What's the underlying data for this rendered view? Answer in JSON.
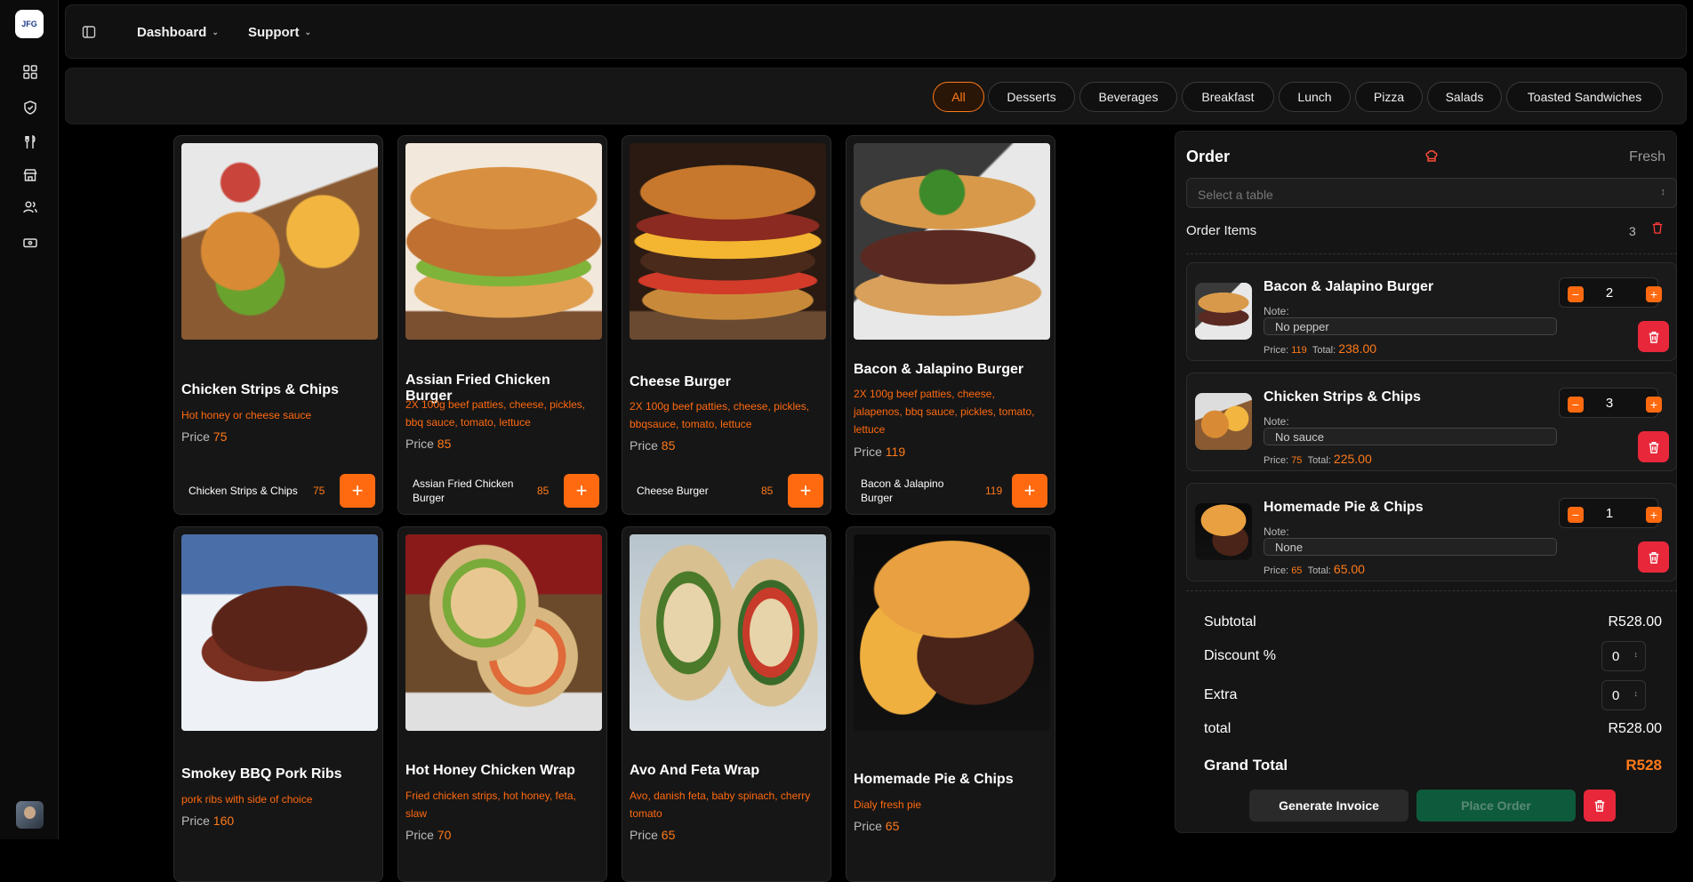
{
  "app": {
    "logo_text": "JFG"
  },
  "topbar": {
    "nav": [
      {
        "label": "Dashboard"
      },
      {
        "label": "Support"
      }
    ]
  },
  "categories": [
    {
      "label": "All",
      "active": true
    },
    {
      "label": "Desserts"
    },
    {
      "label": "Beverages"
    },
    {
      "label": "Breakfast"
    },
    {
      "label": "Lunch"
    },
    {
      "label": "Pizza"
    },
    {
      "label": "Salads"
    },
    {
      "label": "Toasted Sandwiches"
    }
  ],
  "menu_items": [
    {
      "name": "Chicken Strips & Chips",
      "description": "Hot honey or cheese sauce",
      "price_label": "Price",
      "price": "75",
      "footer_name": "Chicken Strips & Chips",
      "footer_price": "75"
    },
    {
      "name": "Assian Fried Chicken Burger",
      "description": "2X 100g beef patties, cheese, pickles, bbq sauce, tomato, lettuce",
      "price_label": "Price",
      "price": "85",
      "footer_name": "Assian Fried Chicken Burger",
      "footer_price": "85"
    },
    {
      "name": "Cheese Burger",
      "description": "2X 100g beef patties, cheese, pickles, bbqsauce, tomato, lettuce",
      "price_label": "Price",
      "price": "85",
      "footer_name": "Cheese Burger",
      "footer_price": "85"
    },
    {
      "name": "Bacon & Jalapino Burger",
      "description": "2X 100g beef patties, cheese, jalapenos, bbq sauce, pickles, tomato, lettuce",
      "price_label": "Price",
      "price": "119",
      "footer_name": "Bacon & Jalapino Burger",
      "footer_price": "119"
    },
    {
      "name": "Smokey BBQ Pork Ribs",
      "description": "pork ribs with side of choice",
      "price_label": "Price",
      "price": "160"
    },
    {
      "name": "Hot Honey Chicken Wrap",
      "description": "Fried chicken strips, hot honey, feta, slaw",
      "price_label": "Price",
      "price": "70"
    },
    {
      "name": "Avo And Feta Wrap",
      "description": "Avo, danish feta, baby spinach, cherry tomato",
      "price_label": "Price",
      "price": "65"
    },
    {
      "name": "Homemade Pie & Chips",
      "description": "Dialy fresh pie",
      "price_label": "Price",
      "price": "65"
    }
  ],
  "order": {
    "title": "Order",
    "status": "Fresh",
    "table_placeholder": "Select a table",
    "items_label": "Order Items",
    "items_count": "3",
    "note_label": "Note:",
    "price_label": "Price:",
    "total_label": "Total:",
    "items": [
      {
        "name": "Bacon & Jalapino Burger",
        "qty": "2",
        "note": "No pepper",
        "price": "119",
        "total": "238.00"
      },
      {
        "name": "Chicken Strips & Chips",
        "qty": "3",
        "note": "No sauce",
        "price": "75",
        "total": "225.00"
      },
      {
        "name": "Homemade Pie & Chips",
        "qty": "1",
        "note": "None",
        "price": "65",
        "total": "65.00"
      }
    ],
    "summary": {
      "subtotal_label": "Subtotal",
      "subtotal": "R528.00",
      "discount_label": "Discount %",
      "discount": "0",
      "extra_label": "Extra",
      "extra": "0",
      "total_label": "total",
      "total": "R528.00",
      "grand_label": "Grand Total",
      "grand": "R528"
    },
    "buttons": {
      "generate": "Generate Invoice",
      "place": "Place Order"
    }
  },
  "colors": {
    "accent": "#ff6a10",
    "danger": "#e8283a",
    "place_order": "#0e5a3c"
  }
}
